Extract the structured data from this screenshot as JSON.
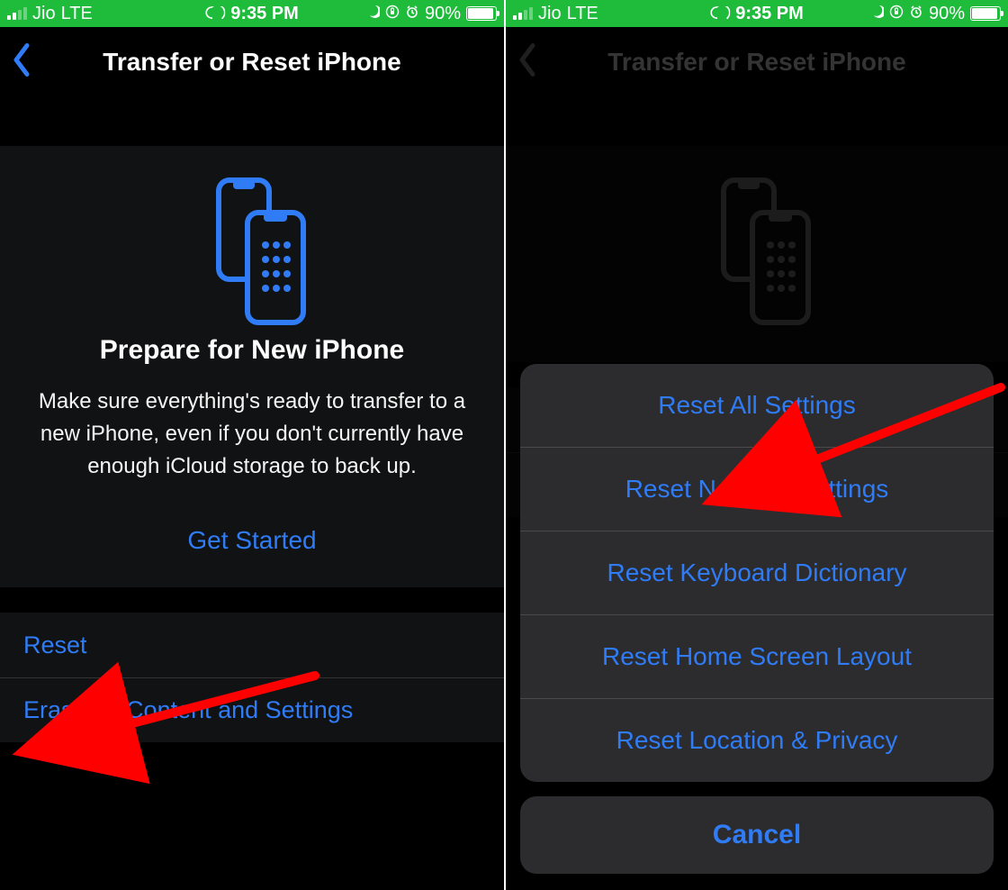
{
  "colors": {
    "accent": "#2f7cf6",
    "statusbar": "#1fbb3b",
    "panel": "#111213",
    "sheet": "#2c2c2e",
    "arrow": "#ff0000"
  },
  "statusbar": {
    "carrier": "Jio",
    "network": "LTE",
    "time": "9:35 PM",
    "battery_percent": "90%",
    "icons": {
      "link": "link-icon",
      "moon": "moon-icon",
      "lock": "lock-rotation-icon",
      "alarm": "alarm-icon"
    }
  },
  "nav": {
    "title": "Transfer or Reset iPhone",
    "back_icon": "chevron-left-icon"
  },
  "hero": {
    "icon": "two-iphones-icon",
    "heading": "Prepare for New iPhone",
    "body": "Make sure everything's ready to transfer to a new iPhone, even if you don't currently have enough iCloud storage to back up.",
    "cta": "Get Started"
  },
  "rows": {
    "reset": "Reset",
    "erase": "Erase All Content and Settings"
  },
  "sheet": {
    "options": [
      "Reset All Settings",
      "Reset Network Settings",
      "Reset Keyboard Dictionary",
      "Reset Home Screen Layout",
      "Reset Location & Privacy"
    ],
    "cancel": "Cancel"
  }
}
